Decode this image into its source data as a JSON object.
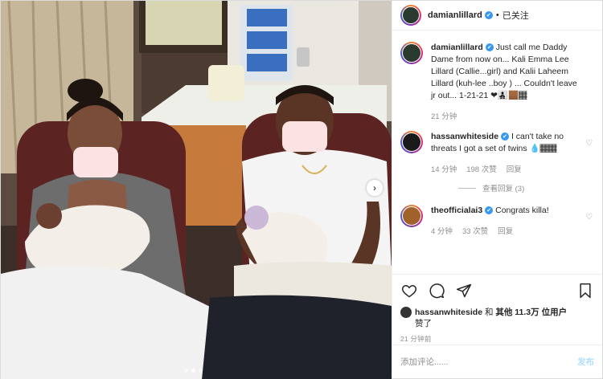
{
  "header": {
    "username": "damianlillard",
    "separator": "•",
    "follow_status": "已关注"
  },
  "caption": {
    "username": "damianlillard",
    "text": "Just call me Daddy Dame from now on... Kali Emma Lee Lillard (Callie...girl) and Kalii Laheem Lillard (kuh-lee ..boy ) ... Couldn't leave jr out... 1-21-21 ❤👨‍👧‍👦🏾🏾",
    "time": "21 分钟"
  },
  "comments": [
    {
      "username": "hassanwhiteside",
      "text": "I can't take no threats I got a set of twins 💧🏾🏾",
      "time": "14 分钟",
      "likes": "198 次赞",
      "reply": "回复",
      "view_replies": "查看回复 (3)"
    },
    {
      "username": "theofficialai3",
      "text": "Congrats killa!",
      "time": "4 分钟",
      "likes": "33 次赞",
      "reply": "回复"
    }
  ],
  "likes_line": {
    "user": "hassanwhiteside",
    "and": "和",
    "others": "其他 11.3万 位用户",
    "suffix": "赞了"
  },
  "post_time": "21 分钟前",
  "add_comment": {
    "placeholder": "添加评论......",
    "post_label": "发布"
  },
  "carousel": {
    "next_glyph": "›",
    "current_index": 2,
    "total": 3
  },
  "icons": [
    "heart-icon",
    "comment-icon",
    "share-icon",
    "bookmark-icon"
  ],
  "colors": {
    "verified": "#3897f0",
    "secondary_text": "#8e8e8e",
    "post_button_disabled": "#b2dffc"
  }
}
